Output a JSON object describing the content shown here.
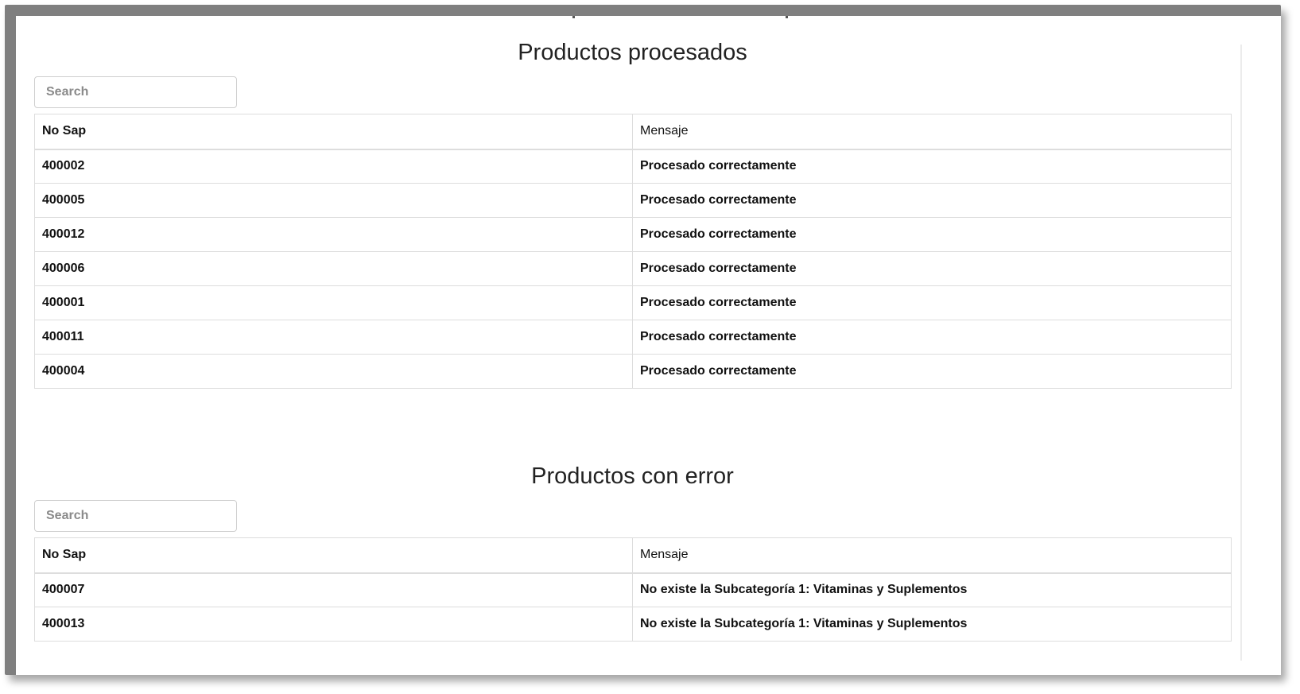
{
  "sections": {
    "processed": {
      "title": "Productos procesados",
      "search_placeholder": "Search",
      "columns": [
        "No Sap",
        "Mensaje"
      ],
      "rows": [
        {
          "no_sap": "400002",
          "mensaje": "Procesado correctamente"
        },
        {
          "no_sap": "400005",
          "mensaje": "Procesado correctamente"
        },
        {
          "no_sap": "400012",
          "mensaje": "Procesado correctamente"
        },
        {
          "no_sap": "400006",
          "mensaje": "Procesado correctamente"
        },
        {
          "no_sap": "400001",
          "mensaje": "Procesado correctamente"
        },
        {
          "no_sap": "400011",
          "mensaje": "Procesado correctamente"
        },
        {
          "no_sap": "400004",
          "mensaje": "Procesado correctamente"
        }
      ]
    },
    "errors": {
      "title": "Productos con error",
      "search_placeholder": "Search",
      "columns": [
        "No Sap",
        "Mensaje"
      ],
      "rows": [
        {
          "no_sap": "400007",
          "mensaje": "No existe la Subcategoría 1: Vitaminas y Suplementos"
        },
        {
          "no_sap": "400013",
          "mensaje": "No existe la Subcategoría 1: Vitaminas y Suplementos"
        }
      ]
    }
  }
}
